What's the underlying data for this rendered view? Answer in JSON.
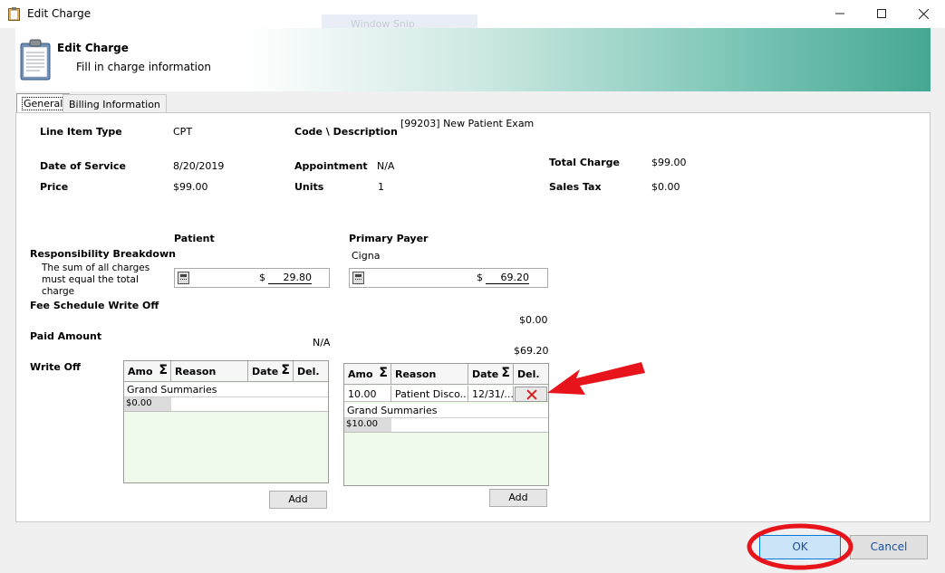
{
  "window": {
    "title": "Edit Charge",
    "ghost_text": "Window Snip"
  },
  "header": {
    "title": "Edit Charge",
    "subtitle": "Fill in charge information"
  },
  "tabs": [
    {
      "label": "General"
    },
    {
      "label": "Billing Information"
    }
  ],
  "fields": {
    "line_item_type": {
      "label": "Line Item Type",
      "value": "CPT"
    },
    "code_description": {
      "label": "Code \\ Description",
      "value": "[99203] New Patient Exam"
    },
    "date_of_service": {
      "label": "Date of Service",
      "value": "8/20/2019"
    },
    "appointment": {
      "label": "Appointment",
      "value": "N/A"
    },
    "total_charge": {
      "label": "Total Charge",
      "value": "$99.00"
    },
    "price": {
      "label": "Price",
      "value": "$99.00"
    },
    "units": {
      "label": "Units",
      "value": "1"
    },
    "sales_tax": {
      "label": "Sales Tax",
      "value": "$0.00"
    }
  },
  "responsibility": {
    "label": "Responsibility Breakdown",
    "note": "The sum of all charges must equal the total charge",
    "patient": {
      "label": "Patient",
      "currency": "$",
      "amount": "29.80"
    },
    "primary_payer": {
      "label": "Primary Payer",
      "name": "Cigna",
      "currency": "$",
      "amount": "69.20"
    }
  },
  "fee_schedule": {
    "label": "Fee Schedule Write Off",
    "payer_value": "$0.00"
  },
  "paid_amount": {
    "label": "Paid Amount",
    "patient_value": "N/A",
    "payer_value": "$69.20"
  },
  "write_off": {
    "label": "Write Off",
    "columns": [
      "Amo",
      "Reason",
      "Date",
      "Del."
    ],
    "patient_grid": {
      "rows": [],
      "summary_label": "Grand Summaries",
      "summary_value": "$0.00",
      "add_label": "Add"
    },
    "payer_grid": {
      "rows": [
        {
          "amount": "10.00",
          "reason": "Patient Disco...",
          "date": "12/31/..."
        }
      ],
      "summary_label": "Grand Summaries",
      "summary_value": "$10.00",
      "add_label": "Add"
    }
  },
  "footer": {
    "ok_label": "OK",
    "cancel_label": "Cancel"
  },
  "colors": {
    "annotation_red": "#e8141c",
    "header_teal": "#45a892"
  }
}
